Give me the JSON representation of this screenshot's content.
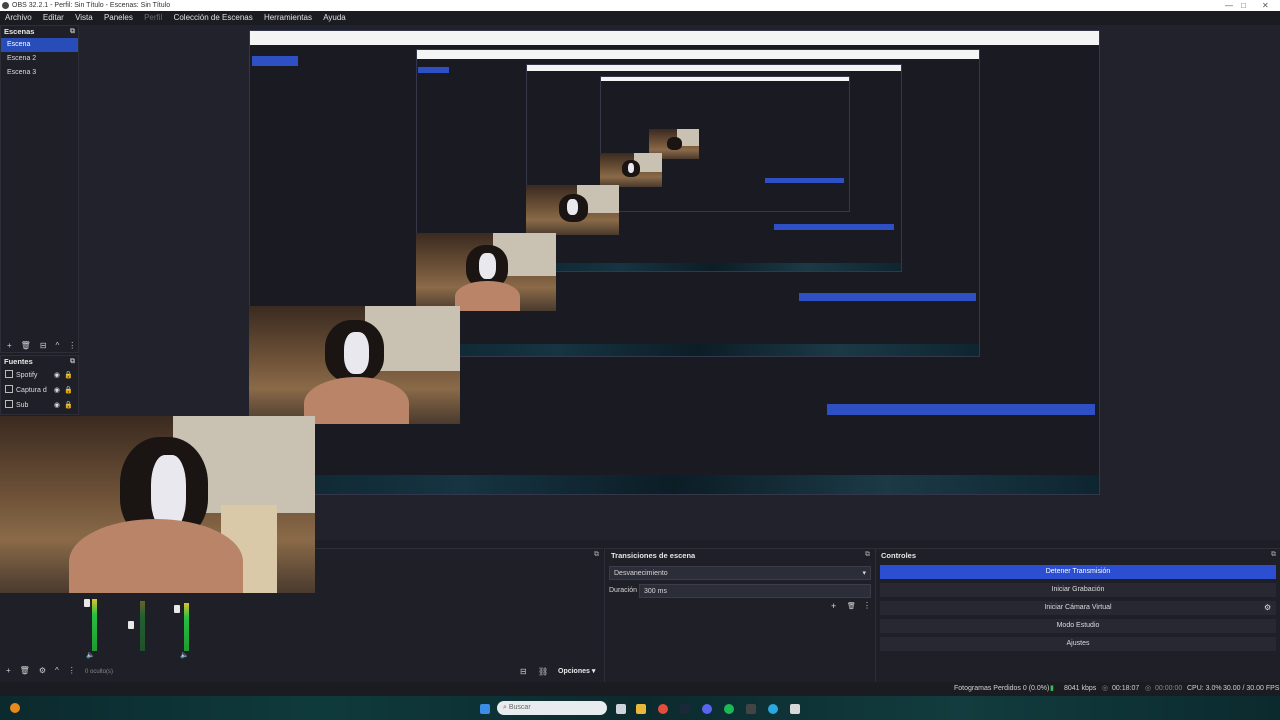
{
  "window": {
    "title": "OBS 32.2.1 - Perfil: Sin Título - Escenas: Sin Título",
    "controls": [
      "—",
      "□",
      "✕"
    ]
  },
  "menu": [
    "Archivo",
    "Editar",
    "Vista",
    "Paneles",
    "Perfil",
    "Colección de Escenas",
    "Herramientas",
    "Ayuda"
  ],
  "scenes": {
    "title": "Escenas",
    "items": [
      "Escena",
      "Escena 2",
      "Escena 3"
    ],
    "selected": 0
  },
  "sources": {
    "title": "Fuentes",
    "items": [
      "Spotify",
      "Captura d",
      "Sub"
    ]
  },
  "mixer": {
    "hidden_label": "0 oculto(s)"
  },
  "transitions": {
    "title": "Transiciones de escena",
    "type": "Desvanecimiento",
    "duration_label": "Duración",
    "duration_value": "300 ms"
  },
  "controls": {
    "title": "Controles",
    "buttons": [
      "Detener Transmisión",
      "Iniciar Grabación",
      "Iniciar Cámara Virtual",
      "Modo Estudio",
      "Ajustes"
    ]
  },
  "options_label": "Opciones",
  "status": {
    "dropped_frames": "Fotogramas Perdidos 0 (0.0%)",
    "bitrate": "8041 kbps",
    "stream_time": "00:18:07",
    "rec_time": "00:00:00",
    "cpu": "CPU: 3.0%",
    "fps": "30.00 / 30.00 FPS"
  },
  "taskbar": {
    "search_placeholder": "Buscar"
  },
  "colors": {
    "accent": "#2b4fd0",
    "panel": "#1f2027",
    "background": "#1e1f26"
  },
  "icons": {
    "add": "add-icon",
    "remove": "trash-icon",
    "settings": "gear-icon",
    "eye": "eye-icon",
    "lock": "lock-icon"
  }
}
